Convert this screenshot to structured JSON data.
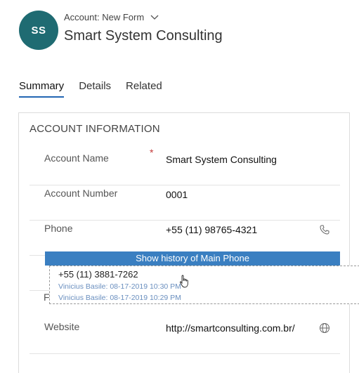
{
  "header": {
    "avatar_initials": "SS",
    "entity_line": "Account: New Form",
    "record_title": "Smart System Consulting"
  },
  "tabs": [
    {
      "label": "Summary",
      "active": true
    },
    {
      "label": "Details",
      "active": false
    },
    {
      "label": "Related",
      "active": false
    }
  ],
  "section": {
    "title": "ACCOUNT INFORMATION",
    "fields": [
      {
        "label": "Account Name",
        "required_mark": "*",
        "value": "Smart System Consulting"
      },
      {
        "label": "Account Number",
        "value": "0001"
      },
      {
        "label": "Phone",
        "value": "+55 (11) 98765-4321",
        "icon": "phone-icon"
      },
      {
        "label": "Website",
        "value": "http://smartconsulting.com.br/",
        "icon": "globe-icon"
      }
    ],
    "partial_label_letter": "F"
  },
  "phone_history": {
    "header": "Show history of Main Phone",
    "value": "+55 (11) 3881-7262",
    "entries": [
      "Vinicius Basile: 08-17-2019 10:30 PM",
      "Vinicius Basile: 08-17-2019 10:29 PM"
    ]
  },
  "colors": {
    "avatar_bg": "#1f6b72",
    "accent": "#2266b3",
    "history_bar": "#3a7fc1",
    "required": "#c43b3b"
  }
}
